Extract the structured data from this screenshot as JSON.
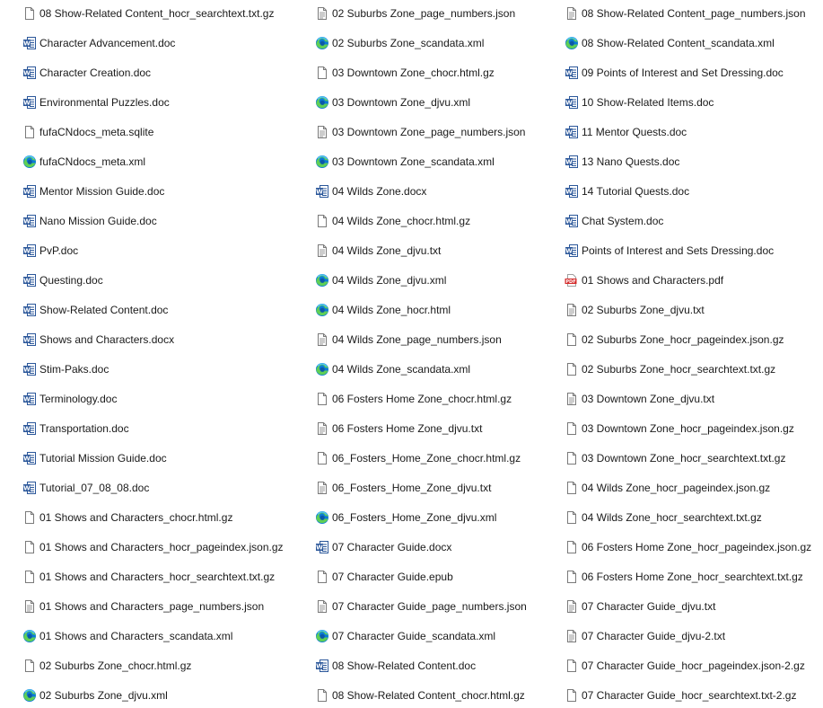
{
  "file_list": {
    "columns": [
      [
        {
          "name": "08 Show-Related Content_hocr_searchtext.txt.gz",
          "icon": "blank-file-icon"
        },
        {
          "name": "Character Advancement.doc",
          "icon": "word-doc-icon"
        },
        {
          "name": "Character Creation.doc",
          "icon": "word-doc-icon"
        },
        {
          "name": "Environmental Puzzles.doc",
          "icon": "word-doc-icon"
        },
        {
          "name": "fufaCNdocs_meta.sqlite",
          "icon": "blank-file-icon"
        },
        {
          "name": "fufaCNdocs_meta.xml",
          "icon": "edge-icon"
        },
        {
          "name": "Mentor Mission Guide.doc",
          "icon": "word-doc-icon"
        },
        {
          "name": "Nano Mission Guide.doc",
          "icon": "word-doc-icon"
        },
        {
          "name": "PvP.doc",
          "icon": "word-doc-icon"
        },
        {
          "name": "Questing.doc",
          "icon": "word-doc-icon"
        },
        {
          "name": "Show-Related Content.doc",
          "icon": "word-doc-icon"
        },
        {
          "name": "Shows and Characters.docx",
          "icon": "word-doc-icon"
        },
        {
          "name": "Stim-Paks.doc",
          "icon": "word-doc-icon"
        },
        {
          "name": "Terminology.doc",
          "icon": "word-doc-icon"
        },
        {
          "name": "Transportation.doc",
          "icon": "word-doc-icon"
        },
        {
          "name": "Tutorial Mission Guide.doc",
          "icon": "word-doc-icon"
        },
        {
          "name": "Tutorial_07_08_08.doc",
          "icon": "word-doc-icon"
        },
        {
          "name": "01 Shows and Characters_chocr.html.gz",
          "icon": "blank-file-icon"
        },
        {
          "name": "01 Shows and Characters_hocr_pageindex.json.gz",
          "icon": "blank-file-icon"
        },
        {
          "name": "01 Shows and Characters_hocr_searchtext.txt.gz",
          "icon": "blank-file-icon"
        },
        {
          "name": "01 Shows and Characters_page_numbers.json",
          "icon": "text-file-icon"
        },
        {
          "name": "01 Shows and Characters_scandata.xml",
          "icon": "edge-icon"
        },
        {
          "name": "02 Suburbs Zone_chocr.html.gz",
          "icon": "blank-file-icon"
        },
        {
          "name": "02 Suburbs Zone_djvu.xml",
          "icon": "edge-icon"
        }
      ],
      [
        {
          "name": "02 Suburbs Zone_page_numbers.json",
          "icon": "text-file-icon"
        },
        {
          "name": "02 Suburbs Zone_scandata.xml",
          "icon": "edge-icon"
        },
        {
          "name": "03 Downtown Zone_chocr.html.gz",
          "icon": "blank-file-icon"
        },
        {
          "name": "03 Downtown Zone_djvu.xml",
          "icon": "edge-icon"
        },
        {
          "name": "03 Downtown Zone_page_numbers.json",
          "icon": "text-file-icon"
        },
        {
          "name": "03 Downtown Zone_scandata.xml",
          "icon": "edge-icon"
        },
        {
          "name": "04 Wilds Zone.docx",
          "icon": "word-doc-icon"
        },
        {
          "name": "04 Wilds Zone_chocr.html.gz",
          "icon": "blank-file-icon"
        },
        {
          "name": "04 Wilds Zone_djvu.txt",
          "icon": "text-file-icon"
        },
        {
          "name": "04 Wilds Zone_djvu.xml",
          "icon": "edge-icon"
        },
        {
          "name": "04 Wilds Zone_hocr.html",
          "icon": "edge-icon"
        },
        {
          "name": "04 Wilds Zone_page_numbers.json",
          "icon": "text-file-icon"
        },
        {
          "name": "04 Wilds Zone_scandata.xml",
          "icon": "edge-icon"
        },
        {
          "name": "06 Fosters Home Zone_chocr.html.gz",
          "icon": "blank-file-icon"
        },
        {
          "name": "06 Fosters Home Zone_djvu.txt",
          "icon": "text-file-icon"
        },
        {
          "name": "06_Fosters_Home_Zone_chocr.html.gz",
          "icon": "blank-file-icon"
        },
        {
          "name": "06_Fosters_Home_Zone_djvu.txt",
          "icon": "text-file-icon"
        },
        {
          "name": "06_Fosters_Home_Zone_djvu.xml",
          "icon": "edge-icon"
        },
        {
          "name": "07 Character Guide.docx",
          "icon": "word-doc-icon"
        },
        {
          "name": "07 Character Guide.epub",
          "icon": "blank-file-icon"
        },
        {
          "name": "07 Character Guide_page_numbers.json",
          "icon": "text-file-icon"
        },
        {
          "name": "07 Character Guide_scandata.xml",
          "icon": "edge-icon"
        },
        {
          "name": "08 Show-Related Content.doc",
          "icon": "word-doc-icon"
        },
        {
          "name": "08 Show-Related Content_chocr.html.gz",
          "icon": "blank-file-icon"
        }
      ],
      [
        {
          "name": "08 Show-Related Content_page_numbers.json",
          "icon": "text-file-icon"
        },
        {
          "name": "08 Show-Related Content_scandata.xml",
          "icon": "edge-icon"
        },
        {
          "name": "09 Points of Interest and Set Dressing.doc",
          "icon": "word-doc-icon"
        },
        {
          "name": "10 Show-Related Items.doc",
          "icon": "word-doc-icon"
        },
        {
          "name": "11 Mentor Quests.doc",
          "icon": "word-doc-icon"
        },
        {
          "name": "13 Nano Quests.doc",
          "icon": "word-doc-icon"
        },
        {
          "name": "14 Tutorial Quests.doc",
          "icon": "word-doc-icon"
        },
        {
          "name": "Chat System.doc",
          "icon": "word-doc-icon"
        },
        {
          "name": "Points of Interest and Sets Dressing.doc",
          "icon": "word-doc-icon"
        },
        {
          "name": "01 Shows and Characters.pdf",
          "icon": "pdf-icon"
        },
        {
          "name": "02 Suburbs Zone_djvu.txt",
          "icon": "text-file-icon"
        },
        {
          "name": "02 Suburbs Zone_hocr_pageindex.json.gz",
          "icon": "blank-file-icon"
        },
        {
          "name": "02 Suburbs Zone_hocr_searchtext.txt.gz",
          "icon": "blank-file-icon"
        },
        {
          "name": "03 Downtown Zone_djvu.txt",
          "icon": "text-file-icon"
        },
        {
          "name": "03 Downtown Zone_hocr_pageindex.json.gz",
          "icon": "blank-file-icon"
        },
        {
          "name": "03 Downtown Zone_hocr_searchtext.txt.gz",
          "icon": "blank-file-icon"
        },
        {
          "name": "04 Wilds Zone_hocr_pageindex.json.gz",
          "icon": "blank-file-icon"
        },
        {
          "name": "04 Wilds Zone_hocr_searchtext.txt.gz",
          "icon": "blank-file-icon"
        },
        {
          "name": "06 Fosters Home Zone_hocr_pageindex.json.gz",
          "icon": "blank-file-icon"
        },
        {
          "name": "06 Fosters Home Zone_hocr_searchtext.txt.gz",
          "icon": "blank-file-icon"
        },
        {
          "name": "07 Character Guide_djvu.txt",
          "icon": "text-file-icon"
        },
        {
          "name": "07 Character Guide_djvu-2.txt",
          "icon": "text-file-icon"
        },
        {
          "name": "07 Character Guide_hocr_pageindex.json-2.gz",
          "icon": "blank-file-icon"
        },
        {
          "name": "07 Character Guide_hocr_searchtext.txt-2.gz",
          "icon": "blank-file-icon"
        }
      ]
    ]
  }
}
